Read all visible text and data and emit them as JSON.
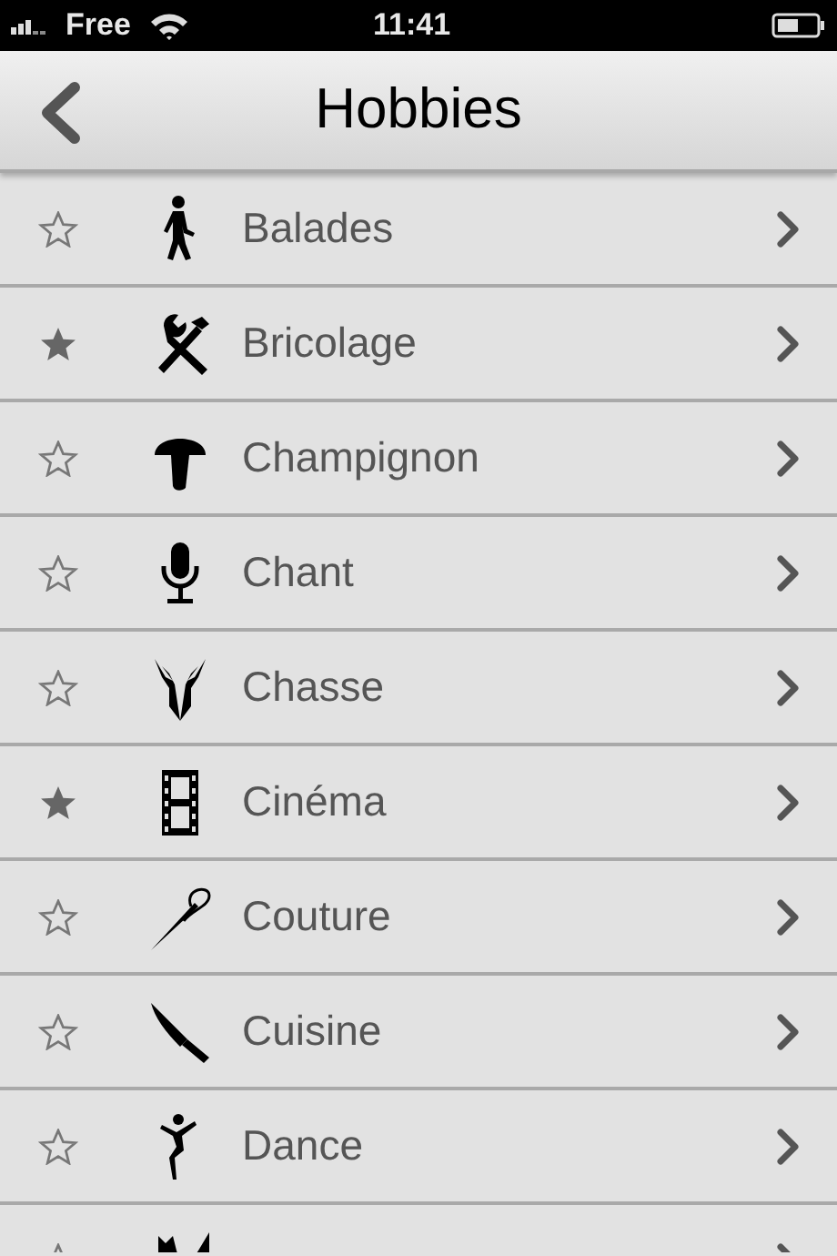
{
  "status_bar": {
    "carrier": "Free",
    "time": "11:41"
  },
  "nav_bar": {
    "title": "Hobbies"
  },
  "items": [
    {
      "label": "Balades",
      "starred": false,
      "kind": "walker"
    },
    {
      "label": "Bricolage",
      "starred": true,
      "kind": "tools"
    },
    {
      "label": "Champignon",
      "starred": false,
      "kind": "mushroom"
    },
    {
      "label": "Chant",
      "starred": false,
      "kind": "microphone"
    },
    {
      "label": "Chasse",
      "starred": false,
      "kind": "deer"
    },
    {
      "label": "Cinéma",
      "starred": true,
      "kind": "film"
    },
    {
      "label": "Couture",
      "starred": false,
      "kind": "needle"
    },
    {
      "label": "Cuisine",
      "starred": false,
      "kind": "knife"
    },
    {
      "label": "Dance",
      "starred": false,
      "kind": "dancer"
    },
    {
      "starred": false,
      "kind": "cat"
    }
  ]
}
